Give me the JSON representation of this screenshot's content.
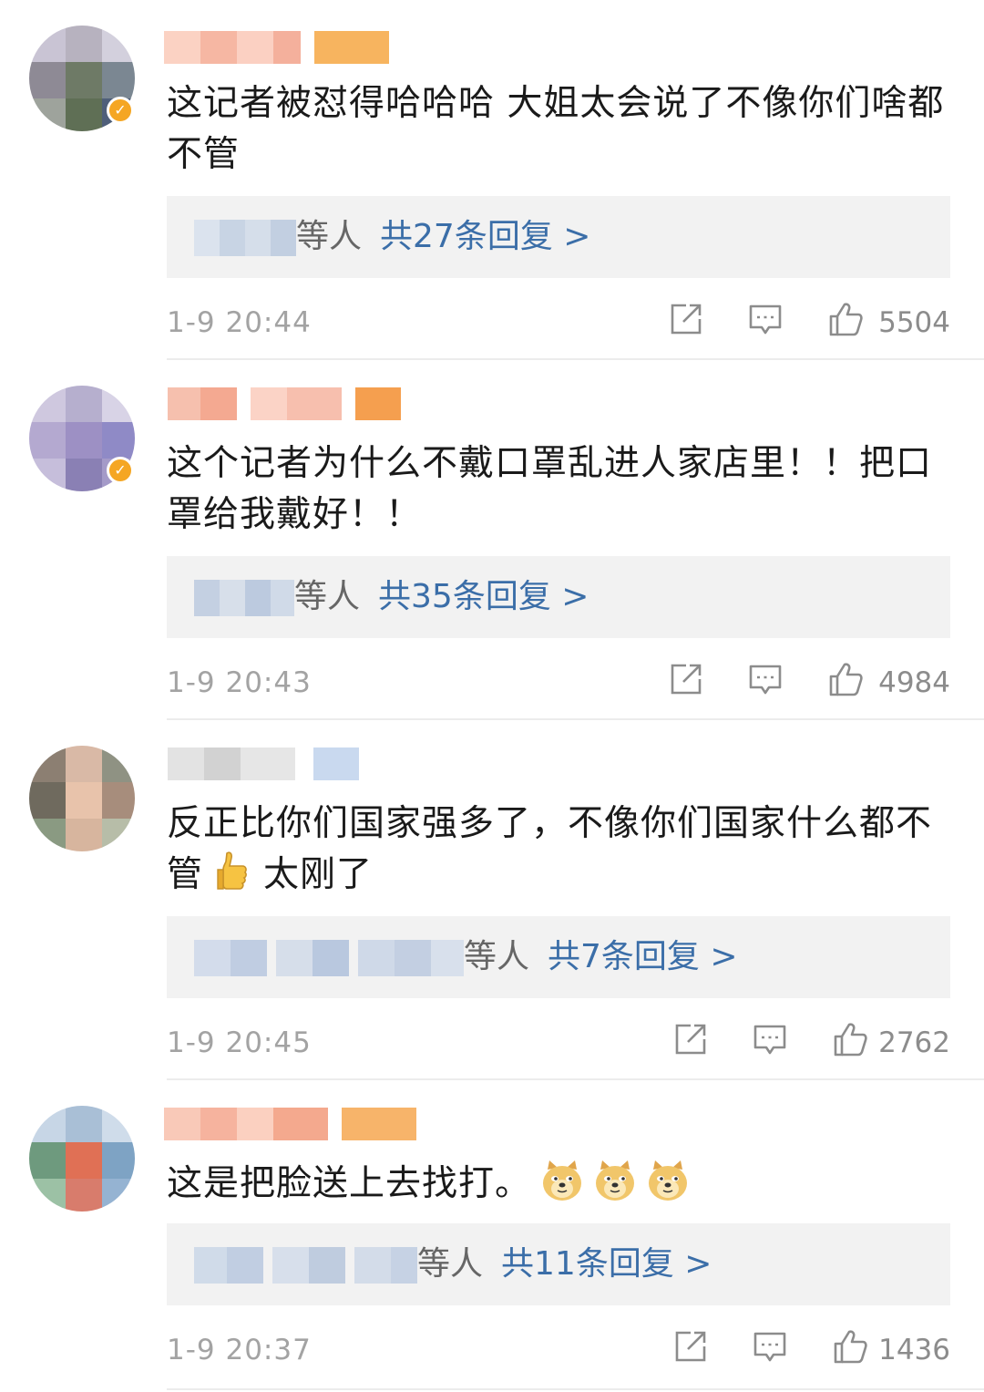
{
  "comments": [
    {
      "text": "这记者被怼得哈哈哈 大姐太会说了不像你们啥都不管",
      "reply_who": "等人",
      "reply_count": "共27条回复 >",
      "time": "1-9 20:44",
      "likes": "5504"
    },
    {
      "text": "这个记者为什么不戴口罩乱进人家店里！！把口罩给我戴好！！",
      "reply_who": "等人",
      "reply_count": "共35条回复 >",
      "time": "1-9 20:43",
      "likes": "4984"
    },
    {
      "text_a": "反正比你们国家强多了，不像你们国家什么都不管",
      "text_b": "太刚了",
      "reply_who": "等人",
      "reply_count": "共7条回复 >",
      "time": "1-9 20:45",
      "likes": "2762"
    },
    {
      "text": "这是把脸送上去找打。",
      "reply_who": "等人",
      "reply_count": "共11条回复 >",
      "time": "1-9 20:37",
      "likes": "1436"
    }
  ],
  "icons": {
    "share": "share-icon",
    "comment": "comment-icon",
    "like": "thumbs-up-icon",
    "emoji_thumb": "thumbs-up-emoji",
    "emoji_doge": "doge-emoji"
  },
  "colors": {
    "reply_link": "#3b6ea8",
    "meta": "#a3a3a3",
    "reply_box": "#f2f2f2",
    "verified_badge": "#f5a623"
  }
}
